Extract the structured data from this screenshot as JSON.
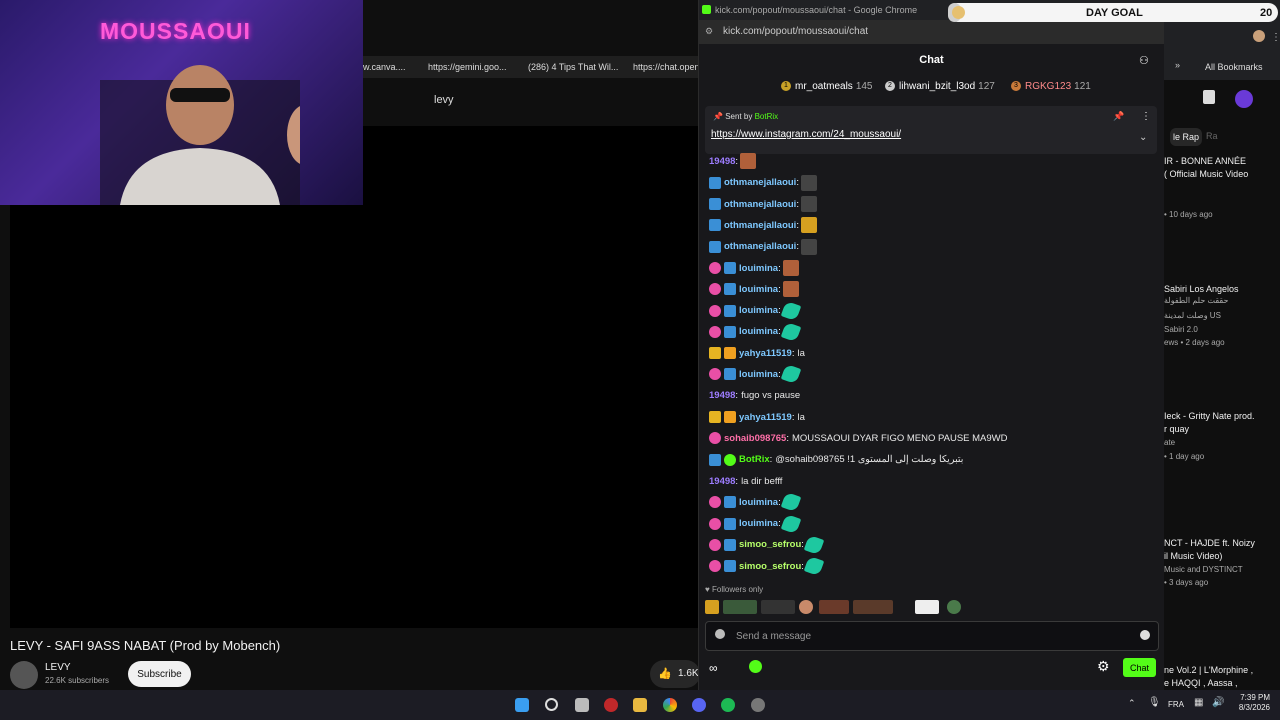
{
  "youtube": {
    "bookmarks": [
      "w.canva....",
      "https://gemini.goo...",
      "(286) 4 Tips That Wil...",
      "https://chat.open..."
    ],
    "search_value": "levy",
    "video_title": "LEVY - SAFI 9ASS NABAT (Prod by Mobench)",
    "channel_name": "LEVY",
    "subscribers": "22.6K subscribers",
    "subscribe_label": "Subscribe",
    "likes": "1.6K",
    "all_bookmarks": "All Bookmarks",
    "chip_1": "le Rap",
    "chip_2": "Ra",
    "recommendations": [
      {
        "title": "IR - BONNE ANNÉE",
        "title2": "( Official Music Video",
        "meta": "• 10 days ago"
      },
      {
        "title": "Sabiri Los Angelos",
        "title2": "حققت حلم الطفولة",
        "title3": "وصلت لمدينة US",
        "channel": "Sabiri 2.0",
        "meta": "ews • 2 days ago"
      },
      {
        "title": "Ieck - Gritty Nate prod.",
        "title2": "r quay",
        "channel": "ate",
        "meta": "• 1 day ago"
      },
      {
        "title": "NCT - HAJDE ft. Noizy",
        "title2": "il Music Video)",
        "channel": "Music and DYSTINCT",
        "meta": "• 3 days ago"
      },
      {
        "title": "ne Vol.2 | L'Morphine ,",
        "title2": "e HAQQI , Aassa ,"
      }
    ]
  },
  "webcam": {
    "overlay_text": "MOUSSAOUI"
  },
  "chat": {
    "window_title": "kick.com/popout/moussaoui/chat - Google Chrome",
    "url": "kick.com/popout/moussaoui/chat",
    "header_title": "Chat",
    "top_gifters": [
      {
        "name": "mr_oatmeals",
        "count": "145",
        "rank": "1"
      },
      {
        "name": "lihwani_bzit_l3od",
        "count": "127",
        "rank": "2"
      },
      {
        "name": "RGKG123",
        "count": "121",
        "rank": "3"
      }
    ],
    "pinned": {
      "sent_by_label": "Sent by",
      "sender": "BotRix",
      "link": "https://www.instagram.com/24_moussaoui/"
    },
    "messages": [
      {
        "user": "19498",
        "color": "#9d7dff",
        "badges": [],
        "text": "",
        "emote": "face"
      },
      {
        "user": "othmanejallaoui",
        "color": "#7ec8ff",
        "badges": [
          "star"
        ],
        "text": "",
        "emote": "dark"
      },
      {
        "user": "othmanejallaoui",
        "color": "#7ec8ff",
        "badges": [
          "star"
        ],
        "text": "",
        "emote": "dark"
      },
      {
        "user": "othmanejallaoui",
        "color": "#7ec8ff",
        "badges": [
          "star"
        ],
        "text": "",
        "emote": "yellow"
      },
      {
        "user": "othmanejallaoui",
        "color": "#7ec8ff",
        "badges": [
          "star"
        ],
        "text": "",
        "emote": "dark"
      },
      {
        "user": "louimina",
        "color": "#7ec8ff",
        "badges": [
          "sub",
          "star"
        ],
        "text": "",
        "emote": "face"
      },
      {
        "user": "louimina",
        "color": "#7ec8ff",
        "badges": [
          "sub",
          "star"
        ],
        "text": "",
        "emote": "face"
      },
      {
        "user": "louimina",
        "color": "#7ec8ff",
        "badges": [
          "sub",
          "star"
        ],
        "text": "",
        "emote": "green"
      },
      {
        "user": "louimina",
        "color": "#7ec8ff",
        "badges": [
          "sub",
          "star"
        ],
        "text": "",
        "emote": "green"
      },
      {
        "user": "yahya11519",
        "color": "#7ec8ff",
        "badges": [
          "gift",
          "crown"
        ],
        "text": "la",
        "emote": ""
      },
      {
        "user": "louimina",
        "color": "#7ec8ff",
        "badges": [
          "sub",
          "star"
        ],
        "text": "",
        "emote": "green"
      },
      {
        "user": "19498",
        "color": "#9d7dff",
        "badges": [],
        "text": "fugo vs pause",
        "emote": ""
      },
      {
        "user": "yahya11519",
        "color": "#7ec8ff",
        "badges": [
          "gift",
          "crown"
        ],
        "text": "la",
        "emote": ""
      },
      {
        "user": "sohaib098765",
        "color": "#ff6fa8",
        "badges": [
          "sub"
        ],
        "text": "MOUSSAOUI DYAR FIGO MENO PAUSE MA9WD",
        "emote": ""
      },
      {
        "user": "BotRix",
        "color": "#53fc18",
        "badges": [
          "star",
          "bot"
        ],
        "text": "@sohaib098765 !بتبريكا وصلت إلى المستوى 1",
        "emote": ""
      },
      {
        "user": "19498",
        "color": "#9d7dff",
        "badges": [],
        "text": "la dir befff",
        "emote": ""
      },
      {
        "user": "louimina",
        "color": "#7ec8ff",
        "badges": [
          "sub",
          "star"
        ],
        "text": "",
        "emote": "green"
      },
      {
        "user": "louimina",
        "color": "#7ec8ff",
        "badges": [
          "sub",
          "star"
        ],
        "text": "",
        "emote": "green"
      },
      {
        "user": "simoo_sefrou",
        "color": "#b6ff6a",
        "badges": [
          "sub",
          "star"
        ],
        "text": "",
        "emote": "green"
      },
      {
        "user": "simoo_sefrou",
        "color": "#b6ff6a",
        "badges": [
          "sub",
          "star"
        ],
        "text": "",
        "emote": "green"
      }
    ],
    "followers_only": "Followers only",
    "input_placeholder": "Send a message",
    "send_label": "Chat"
  },
  "day_goal": {
    "label": "DAY GOAL",
    "count": "20",
    "progress": 0.04
  },
  "taskbar": {
    "language": "FRA",
    "time": "7:39 PM",
    "date": "8/3/2026"
  },
  "colors": {
    "kick_green": "#53fc18",
    "chat_bg": "#18181b",
    "yt_bg": "#0f0f0f"
  }
}
